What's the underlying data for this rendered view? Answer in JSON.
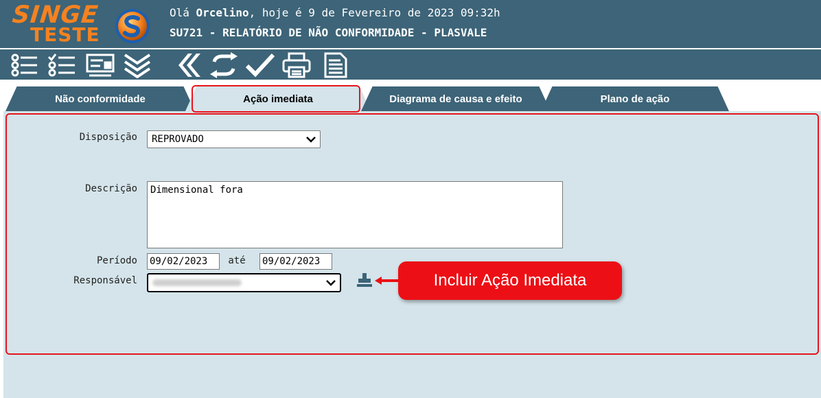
{
  "header": {
    "logo_line1": "SINGE",
    "logo_line2": "TESTE",
    "greeting_prefix": "Olá ",
    "user_name": "Orcelino",
    "greeting_suffix": ", hoje é 9 de Fevereiro de 2023 09:32h",
    "report_title": "SU721 - RELATÓRIO DE NÃO CONFORMIDADE - PLASVALE"
  },
  "toolbar": {
    "icons": [
      "list-icon",
      "checklist-icon",
      "form-icon",
      "expand-all-icon",
      "back-icon",
      "refresh-icon",
      "confirm-icon",
      "print-icon",
      "document-icon"
    ]
  },
  "tabs": [
    {
      "label": "Não conformidade",
      "active": false
    },
    {
      "label": "Ação imediata",
      "active": true
    },
    {
      "label": "Diagrama de causa e efeito",
      "active": false
    },
    {
      "label": "Plano de ação",
      "active": false
    }
  ],
  "form": {
    "disposicao_label": "Disposição",
    "disposicao_value": "REPROVADO",
    "descricao_label": "Descrição",
    "descricao_value": "Dimensional fora",
    "periodo_label": "Período",
    "periodo_start": "09/02/2023",
    "periodo_sep": "até",
    "periodo_end": "09/02/2023",
    "responsavel_label": "Responsável"
  },
  "callout": {
    "text": "Incluir Ação Imediata"
  },
  "colors": {
    "header_bg": "#3d6478",
    "panel_bg": "#d4e4ea",
    "accent_orange": "#f58220",
    "highlight_red": "#e8141c"
  }
}
